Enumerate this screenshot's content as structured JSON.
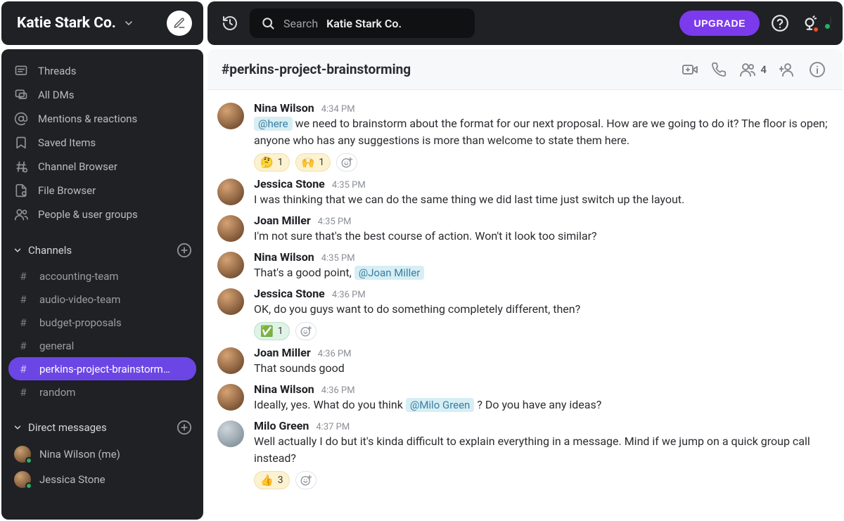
{
  "workspace": {
    "name": "Katie Stark Co."
  },
  "search": {
    "label": "Search",
    "workspace": "Katie Stark Co."
  },
  "upgrade_label": "UPGRADE",
  "sidebar": {
    "nav": [
      {
        "label": "Threads",
        "icon": "threads-icon"
      },
      {
        "label": "All DMs",
        "icon": "dms-icon"
      },
      {
        "label": "Mentions & reactions",
        "icon": "mentions-icon"
      },
      {
        "label": "Saved Items",
        "icon": "bookmark-icon"
      },
      {
        "label": "Channel Browser",
        "icon": "channel-browser-icon"
      },
      {
        "label": "File Browser",
        "icon": "file-browser-icon"
      },
      {
        "label": "People & user groups",
        "icon": "people-icon"
      }
    ],
    "channels_header": "Channels",
    "channels": [
      {
        "name": "accounting-team",
        "active": false
      },
      {
        "name": "audio-video-team",
        "active": false
      },
      {
        "name": "budget-proposals",
        "active": false
      },
      {
        "name": "general",
        "active": false
      },
      {
        "name": "perkins-project-brainstorm…",
        "active": true
      },
      {
        "name": "random",
        "active": false
      }
    ],
    "dms_header": "Direct messages",
    "dms": [
      {
        "name": "Nina Wilson (me)"
      },
      {
        "name": "Jessica Stone"
      }
    ]
  },
  "channel": {
    "title": "#perkins-project-brainstorming",
    "member_count": "4"
  },
  "messages": [
    {
      "author": "Nina Wilson",
      "time": "4:34 PM",
      "segments": [
        {
          "mention": "@here"
        },
        {
          "text": "  we need to brainstorm about the format for our next proposal. How are we going to do it? The floor is open; anyone who has any suggestions is more than welcome to state them here."
        }
      ],
      "reactions": [
        {
          "emoji": "🤔",
          "count": "1",
          "style": "gold"
        },
        {
          "emoji": "🙌",
          "count": "1",
          "style": "gold"
        }
      ],
      "show_add_reaction": true
    },
    {
      "author": "Jessica Stone",
      "time": "4:35 PM",
      "segments": [
        {
          "text": "I was thinking that we can do the same thing we did last time just switch up the layout."
        }
      ]
    },
    {
      "author": "Joan Miller",
      "time": "4:35 PM",
      "segments": [
        {
          "text": "I'm not sure that's the best course of action. Won't it look too similar?"
        }
      ]
    },
    {
      "author": "Nina Wilson",
      "time": "4:35 PM",
      "segments": [
        {
          "text": "That's a good point, "
        },
        {
          "mention": "@Joan Miller"
        }
      ]
    },
    {
      "author": "Jessica Stone",
      "time": "4:36 PM",
      "segments": [
        {
          "text": "OK, do you guys want to do something completely different, then?"
        }
      ],
      "reactions": [
        {
          "emoji": "✅",
          "count": "1",
          "style": "mine"
        }
      ],
      "show_add_reaction": true
    },
    {
      "author": "Joan Miller",
      "time": "4:36 PM",
      "segments": [
        {
          "text": "That sounds good"
        }
      ]
    },
    {
      "author": "Nina Wilson",
      "time": "4:36 PM",
      "segments": [
        {
          "text": "Ideally, yes. What do you think "
        },
        {
          "mention": "@Milo Green"
        },
        {
          "text": " ? Do you have any ideas?"
        }
      ]
    },
    {
      "author": "Milo Green",
      "time": "4:37 PM",
      "male": true,
      "segments": [
        {
          "text": "Well actually I do but it's kinda difficult to explain everything in a message. Mind if we jump on a quick group call instead?"
        }
      ],
      "reactions": [
        {
          "emoji": "👍",
          "count": "3",
          "style": "gold"
        }
      ],
      "show_add_reaction": true
    }
  ]
}
